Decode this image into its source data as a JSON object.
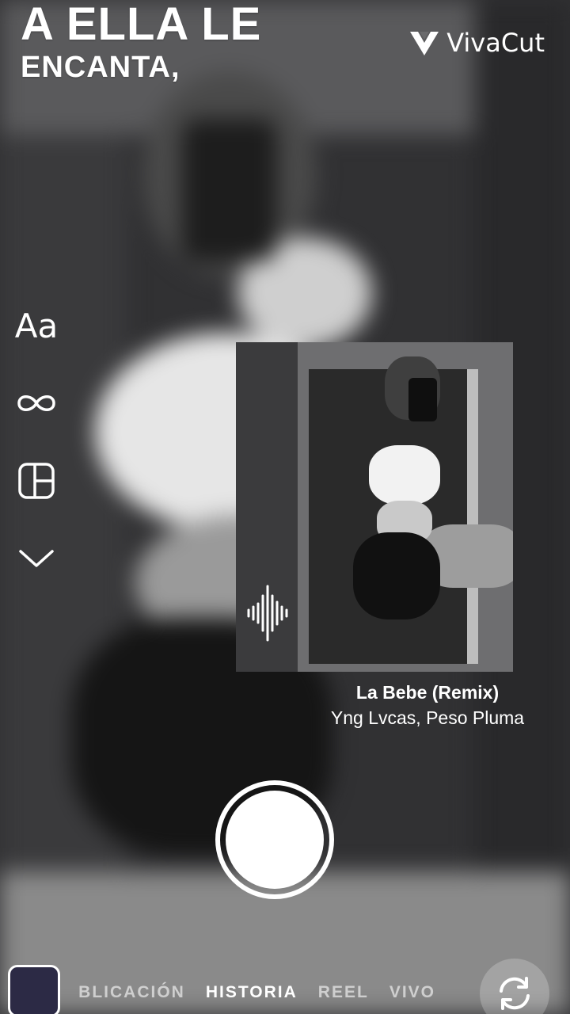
{
  "overlay_text": {
    "line1": "A ELLA LE",
    "line2": "ENCANTA,"
  },
  "watermark": {
    "brand": "VivaCut",
    "icon": "vivacut-logo-icon"
  },
  "toolbar": {
    "text_tool_label": "Aa",
    "items": [
      "text-tool",
      "boomerang-infinity-icon",
      "layout-grid-icon",
      "chevron-down-icon"
    ]
  },
  "music_sticker": {
    "icon": "audio-waveform-icon",
    "song_title": "La Bebe (Remix)",
    "artist": "Yng Lvcas, Peso Pluma"
  },
  "camera": {
    "modes": [
      "UBLICACIÓN",
      "HISTORIA",
      "REEL",
      "VIVO"
    ],
    "active_mode": "HISTORIA",
    "shutter_icon": "shutter-button",
    "flip_icon": "flip-camera-icon",
    "gallery_icon": "gallery-thumbnail"
  },
  "colors": {
    "text": "#ffffff",
    "background": "#313133"
  }
}
